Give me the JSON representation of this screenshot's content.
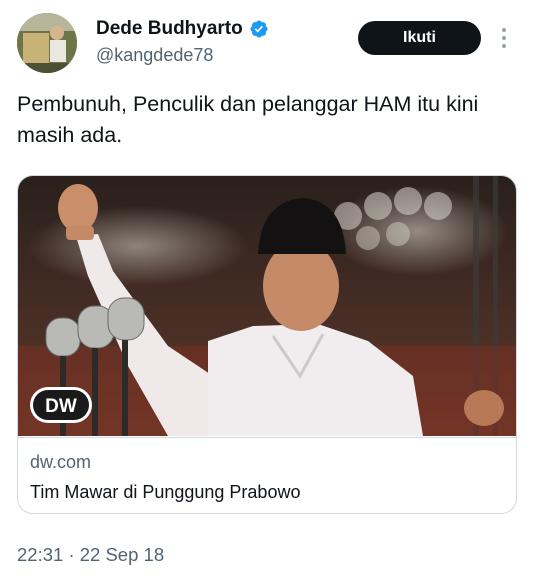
{
  "tweet": {
    "author": {
      "display_name": "Dede Budhyarto",
      "handle": "@kangdede78",
      "verified": true,
      "verified_color": "#1d9bf0"
    },
    "follow_label": "Ikuti",
    "more_icon": "more-vertical-icon",
    "text": "Pembunuh, Penculik dan pelanggar HAM itu kini masih ada.",
    "card": {
      "source_logo": "DW",
      "domain": "dw.com",
      "title": "Tim Mawar di Punggung Prabowo"
    },
    "time": "22:31",
    "separator": "·",
    "date": "22 Sep 18"
  }
}
